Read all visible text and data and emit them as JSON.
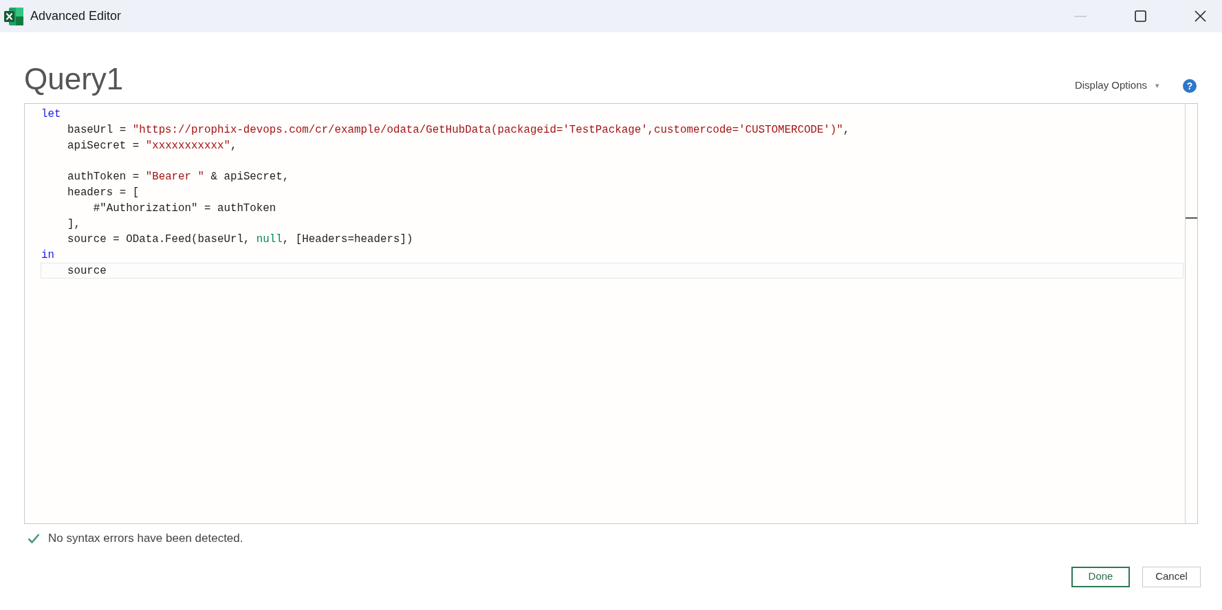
{
  "window": {
    "title": "Advanced Editor"
  },
  "query_name": "Query1",
  "display_options": {
    "label": "Display Options",
    "caret": "▾"
  },
  "help": {
    "glyph": "?"
  },
  "editor": {
    "lines": [
      {
        "current": false,
        "tokens": [
          {
            "kind": "keyword",
            "text": "let"
          }
        ]
      },
      {
        "current": false,
        "tokens": [
          {
            "kind": "plain",
            "text": "    baseUrl = "
          },
          {
            "kind": "string",
            "text": "\"https://prophix-devops.com/cr/example/odata/GetHubData(packageid='TestPackage',customercode='CUSTOMERCODE')\""
          },
          {
            "kind": "plain",
            "text": ","
          }
        ]
      },
      {
        "current": false,
        "tokens": [
          {
            "kind": "plain",
            "text": "    apiSecret = "
          },
          {
            "kind": "string",
            "text": "\"xxxxxxxxxxx\""
          },
          {
            "kind": "plain",
            "text": ","
          }
        ]
      },
      {
        "current": false
      },
      {
        "current": false,
        "tokens": [
          {
            "kind": "plain",
            "text": "    authToken = "
          },
          {
            "kind": "string",
            "text": "\"Bearer \""
          },
          {
            "kind": "plain",
            "text": " & apiSecret,"
          }
        ]
      },
      {
        "current": false,
        "tokens": [
          {
            "kind": "plain",
            "text": "    headers = ["
          }
        ]
      },
      {
        "current": false,
        "tokens": [
          {
            "kind": "plain",
            "text": "        #\"Authorization\" = authToken"
          }
        ]
      },
      {
        "current": false,
        "tokens": [
          {
            "kind": "plain",
            "text": "    ],"
          }
        ]
      },
      {
        "current": false,
        "tokens": [
          {
            "kind": "plain",
            "text": "    source = OData.Feed(baseUrl, "
          },
          {
            "kind": "literal",
            "text": "null"
          },
          {
            "kind": "plain",
            "text": ", [Headers=headers])"
          }
        ]
      },
      {
        "current": false,
        "tokens": [
          {
            "kind": "keyword",
            "text": "in"
          }
        ]
      },
      {
        "current": true,
        "tokens": [
          {
            "kind": "plain",
            "text": "    source"
          }
        ]
      }
    ]
  },
  "status": {
    "text": "No syntax errors have been detected."
  },
  "buttons": [
    {
      "label": "Done",
      "primary": true
    },
    {
      "label": "Cancel",
      "primary": false
    }
  ]
}
